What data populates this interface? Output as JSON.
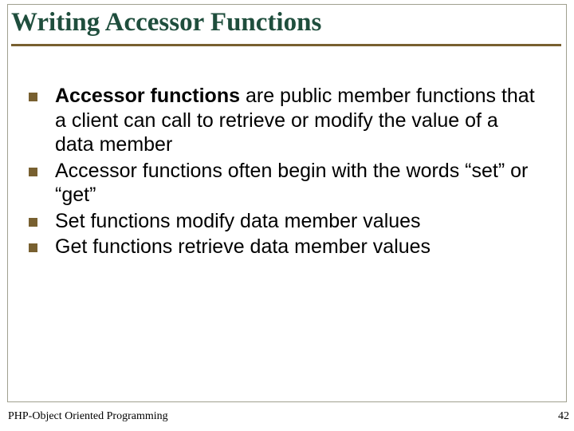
{
  "title": "Writing Accessor Functions",
  "bullets": [
    {
      "bold": "Accessor functions",
      "rest": " are public member functions that a client can call to retrieve or modify the value of a data member"
    },
    {
      "bold": "",
      "rest": "Accessor functions often begin with the words “set” or “get”"
    },
    {
      "bold": "",
      "rest": "Set functions modify data member values"
    },
    {
      "bold": "",
      "rest": "Get functions retrieve data member values"
    }
  ],
  "footer": {
    "left": "PHP-Object Oriented Programming",
    "page": "42"
  }
}
